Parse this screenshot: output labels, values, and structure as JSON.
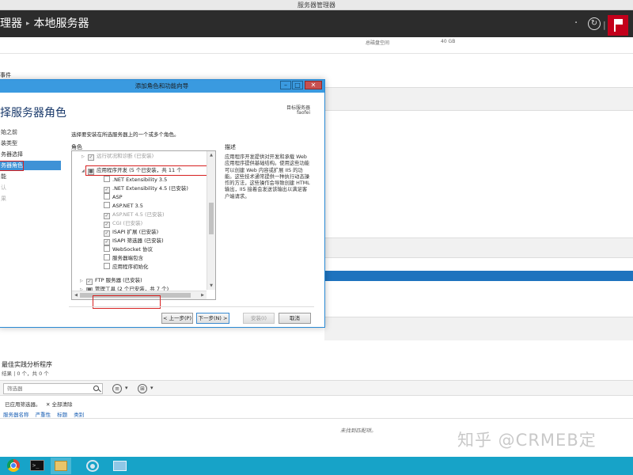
{
  "os_window": {
    "title": "服务器管理器"
  },
  "server_manager": {
    "breadcrumb_parent": "理器",
    "breadcrumb_current": "本地服务器",
    "disk_label": "总磁盘空间",
    "disk_value": "40 GB",
    "events_title": "事件"
  },
  "wizard": {
    "title": "添加角色和功能向导",
    "page_title": "择服务器角色",
    "target_label": "目标服务器",
    "target_name": "faofei",
    "steps": [
      {
        "label": "始之前",
        "state": "normal"
      },
      {
        "label": "装类型",
        "state": "normal"
      },
      {
        "label": "务器选择",
        "state": "normal"
      },
      {
        "label": "务器角色",
        "state": "active"
      },
      {
        "label": "能",
        "state": "normal"
      },
      {
        "label": "认",
        "state": "disabled"
      },
      {
        "label": "果",
        "state": "disabled"
      }
    ],
    "instruction": "选择要安装在所选服务器上的一个或多个角色。",
    "roles_label": "角色",
    "description_label": "描述",
    "roles": [
      {
        "label": "远行状况和诊断 (已安装)",
        "checked": true,
        "indent": 1,
        "expander": "▷",
        "dim": true
      },
      {
        "label": "应用程序开发 (5 个已安装，共 11 个",
        "checked": true,
        "indent": 1,
        "expander": "◢",
        "dim": false
      },
      {
        "label": ".NET Extensibility 3.5",
        "checked": false,
        "indent": 2,
        "expander": "",
        "dim": false
      },
      {
        "label": ".NET Extensibility 4.5 (已安装)",
        "checked": true,
        "indent": 2,
        "expander": "",
        "dim": false
      },
      {
        "label": "ASP",
        "checked": false,
        "indent": 2,
        "expander": "",
        "dim": false
      },
      {
        "label": "ASP.NET 3.5",
        "checked": false,
        "indent": 2,
        "expander": "",
        "dim": false
      },
      {
        "label": "ASP.NET 4.5 (已安装)",
        "checked": true,
        "indent": 2,
        "expander": "",
        "dim": true
      },
      {
        "label": "CGI (已安装)",
        "checked": true,
        "indent": 2,
        "expander": "",
        "dim": true
      },
      {
        "label": "ISAPI 扩展 (已安装)",
        "checked": true,
        "indent": 2,
        "expander": "",
        "dim": false
      },
      {
        "label": "ISAPI 筛选器 (已安装)",
        "checked": true,
        "indent": 2,
        "expander": "",
        "dim": false
      },
      {
        "label": "WebSocket 协议",
        "checked": false,
        "indent": 2,
        "expander": "",
        "dim": false
      },
      {
        "label": "服务器端包含",
        "checked": false,
        "indent": 2,
        "expander": "",
        "dim": false
      },
      {
        "label": "应用程序初始化",
        "checked": false,
        "indent": 2,
        "expander": "",
        "dim": false
      },
      {
        "label": "FTP 服务器 (已安装)",
        "checked": true,
        "indent": 0,
        "expander": "▷",
        "dim": false
      },
      {
        "label": "管理工具 (2 个已安装，共 7 个)",
        "checked": true,
        "indent": 0,
        "expander": "▷",
        "dim": false
      }
    ],
    "description": "应用程序开发提供对开发和承载 Web 应用程序提供基础结构。使用这些功能可以创建 Web 内容或扩展 IIS 的功能。这些技术通常提供一种执行动态操作的方法，这些操作会导致创建 HTML 输出，IIS 接着会发送该输出以满足客户端请求。",
    "buttons": {
      "prev": "< 上一步(P)",
      "next": "下一步(N) >",
      "install": "安装(I)",
      "cancel": "取消"
    }
  },
  "bpa": {
    "title": "最佳实践分析程序",
    "subtitle": "结果 | 0 个，共 0 个",
    "filter_placeholder": "筛选器",
    "applied_filter": "已应用筛选器。",
    "clear_all": "全部清除",
    "columns": [
      "服务器名称",
      "严重性",
      "标题",
      "类别"
    ],
    "empty_message": "未找到匹配项。"
  },
  "watermark": "知乎 @CRMEB定",
  "taskbar": {
    "items": [
      "chrome-icon",
      "command-prompt-icon",
      "file-explorer-icon",
      "server-manager-icon",
      "network-icon"
    ]
  },
  "colors": {
    "accent": "#3a9ae0",
    "highlight_red": "#d62020",
    "taskbar": "#17a3c8",
    "header": "#2c2c2c",
    "flag": "#c3001b"
  }
}
